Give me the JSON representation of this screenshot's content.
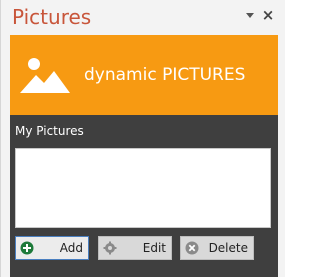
{
  "pane": {
    "title": "Pictures",
    "menu_icon": "dropdown-arrow-icon",
    "close_icon": "close-icon",
    "close_glyph": "×"
  },
  "banner": {
    "icon": "picture-icon",
    "text": "dynamic PICTURES",
    "color": "#f79a12"
  },
  "content": {
    "label": "My Pictures",
    "background": "#3f3f3f",
    "pictures": []
  },
  "buttons": {
    "add": {
      "label": "Add",
      "icon": "add-icon",
      "icon_color": "#1e7a3a"
    },
    "edit": {
      "label": "Edit",
      "icon": "gear-icon"
    },
    "delete": {
      "label": "Delete",
      "icon": "delete-icon"
    }
  }
}
